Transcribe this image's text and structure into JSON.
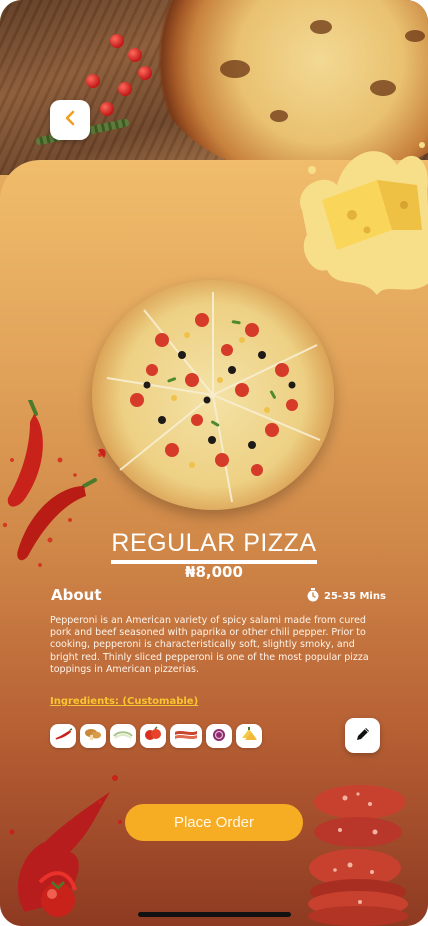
{
  "product": {
    "name": "REGULAR PIZZA",
    "price": "₦8,000"
  },
  "about": {
    "heading": "About",
    "prep_time": "25-35 Mins",
    "description": "Pepperoni is an American variety of spicy salami made from cured pork and beef seasoned with paprika or other chili pepper. Prior to cooking, pepperoni is characteristically soft, slightly smoky, and bright red. Thinly sliced pepperoni is one of the most popular pizza toppings in American pizzerias."
  },
  "ingredients": {
    "label": "Ingredients: (Customable)",
    "items": [
      "chilli-icon",
      "mushroom-icon",
      "onion-icon",
      "tomato-icon",
      "bacon-icon",
      "red-onion-icon",
      "pineapple-icon"
    ]
  },
  "actions": {
    "place_order": "Place Order"
  },
  "icons": {
    "back": "chevron-left-icon",
    "timer": "stopwatch-icon",
    "edit": "pencil-icon"
  },
  "colors": {
    "accent": "#f6ac23",
    "ingredients_label": "#f9c531",
    "back_chevron": "#f0a020"
  }
}
